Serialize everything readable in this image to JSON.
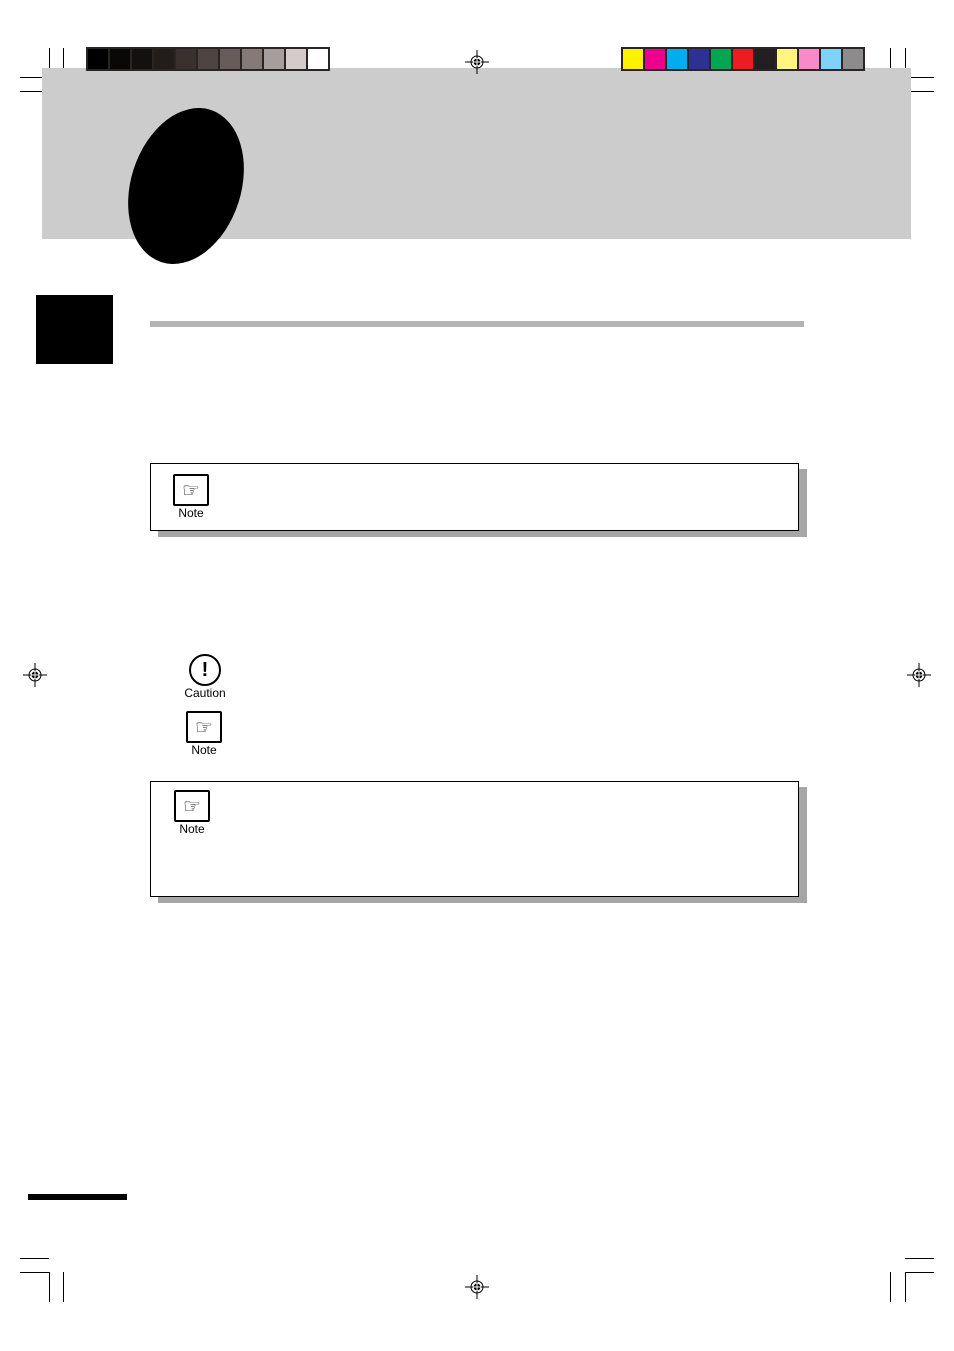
{
  "color_bars": {
    "grayscale": [
      "#000000",
      "#0a0807",
      "#141010",
      "#221c1a",
      "#3a302e",
      "#4e4542",
      "#675c5a",
      "#857a78",
      "#a59e9c",
      "#d4cccb",
      "#ffffff"
    ],
    "process": [
      "#fff200",
      "#ec008c",
      "#00aeef",
      "#2e3192",
      "#00a651",
      "#ed1c24",
      "#231f20",
      "#fff57f",
      "#f68bc8",
      "#7fd3f7",
      "#8c8c8c"
    ]
  },
  "icons": {
    "note_label": "Note",
    "caution_label": "Caution",
    "caution_glyph": "!",
    "hand_glyph": "☞"
  },
  "colors": {
    "header_band": "#cccccc",
    "rule": "#b3b3b3",
    "box_shadow": "#a6a6a6"
  }
}
